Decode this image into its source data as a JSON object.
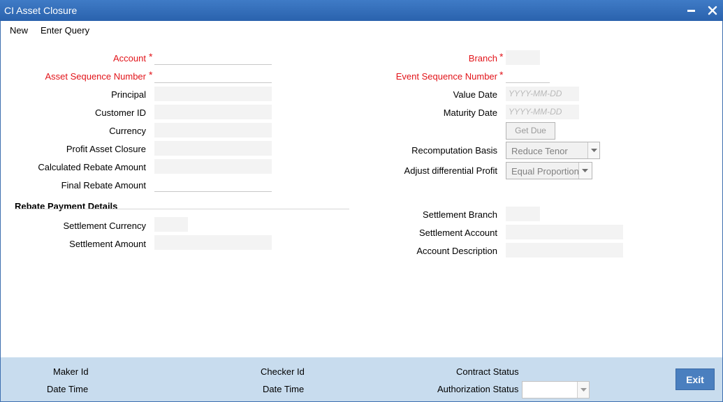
{
  "window": {
    "title": "CI Asset Closure"
  },
  "menu": {
    "new": "New",
    "enter_query": "Enter Query"
  },
  "left_fields": {
    "account": "Account",
    "asset_sequence_number": "Asset Sequence Number",
    "principal": "Principal",
    "customer_id": "Customer ID",
    "currency": "Currency",
    "profit_asset_closure": "Profit Asset Closure",
    "calculated_rebate_amount": "Calculated Rebate Amount",
    "final_rebate_amount": "Final Rebate Amount"
  },
  "right_fields": {
    "branch": "Branch",
    "event_sequence_number": "Event Sequence Number",
    "value_date": "Value Date",
    "value_date_placeholder": "YYYY-MM-DD",
    "maturity_date": "Maturity Date",
    "maturity_date_placeholder": "YYYY-MM-DD",
    "get_due": "Get Due",
    "recomputation_basis": "Recomputation Basis",
    "recomputation_basis_value": "Reduce Tenor",
    "adjust_differential_profit": "Adjust differential Profit",
    "adjust_differential_profit_value": "Equal Proportion"
  },
  "rebate_payment": {
    "title": "Rebate Payment Details",
    "settlement_currency": "Settlement Currency",
    "settlement_amount": "Settlement Amount",
    "settlement_branch": "Settlement Branch",
    "settlement_account": "Settlement Account",
    "account_description": "Account Description"
  },
  "required_marker": "*",
  "footer": {
    "maker_id": "Maker Id",
    "maker_date_time": "Date Time",
    "checker_id": "Checker Id",
    "checker_date_time": "Date Time",
    "contract_status": "Contract Status",
    "authorization_status": "Authorization Status",
    "exit": "Exit"
  },
  "colors": {
    "title_bar": "#2f6bb7",
    "required": "#e2141a",
    "footer": "#c8dcee",
    "exit_button": "#4a7fbf"
  }
}
